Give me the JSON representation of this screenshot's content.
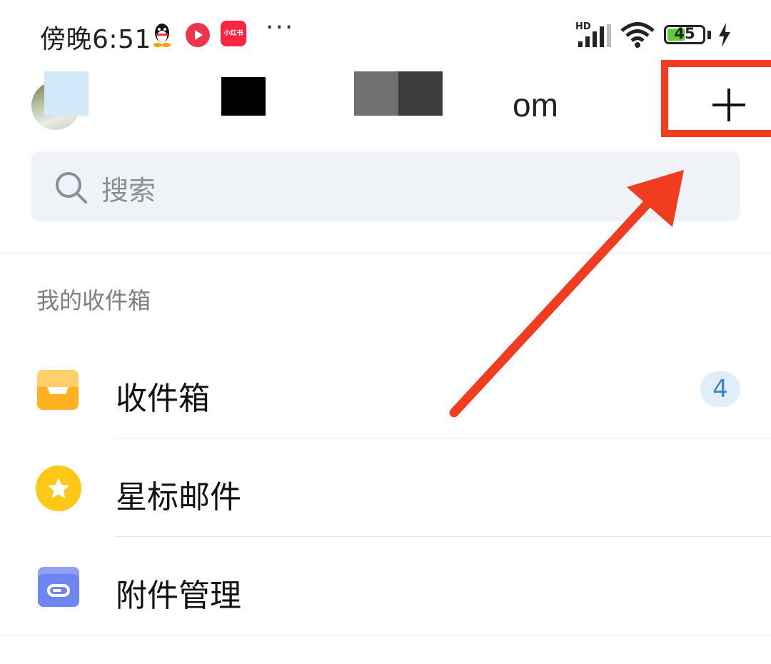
{
  "status_bar": {
    "time": "傍晚6:51",
    "more": "···",
    "signal_label": "HD",
    "battery_level": "45",
    "app_icons": [
      "qq-icon",
      "red-play-icon",
      "xiaohongshu-icon"
    ],
    "xhs_label": "小红书"
  },
  "header": {
    "account_visible_suffix": "om",
    "add_icon": "plus-icon"
  },
  "search": {
    "placeholder": "搜索",
    "icon": "search-icon"
  },
  "section": {
    "title": "我的收件箱"
  },
  "folders": [
    {
      "label": "收件箱",
      "icon": "inbox-tray-icon",
      "icon_color": "#FFB120",
      "badge": "4"
    },
    {
      "label": "星标邮件",
      "icon": "star-icon",
      "icon_color": "#FFC816"
    },
    {
      "label": "附件管理",
      "icon": "attachment-folder-icon",
      "icon_color": "#6F85F2"
    }
  ],
  "colors": {
    "highlight": "#F03C20",
    "badge_text": "#3A87C8",
    "badge_bg": "#E0EEF8"
  }
}
